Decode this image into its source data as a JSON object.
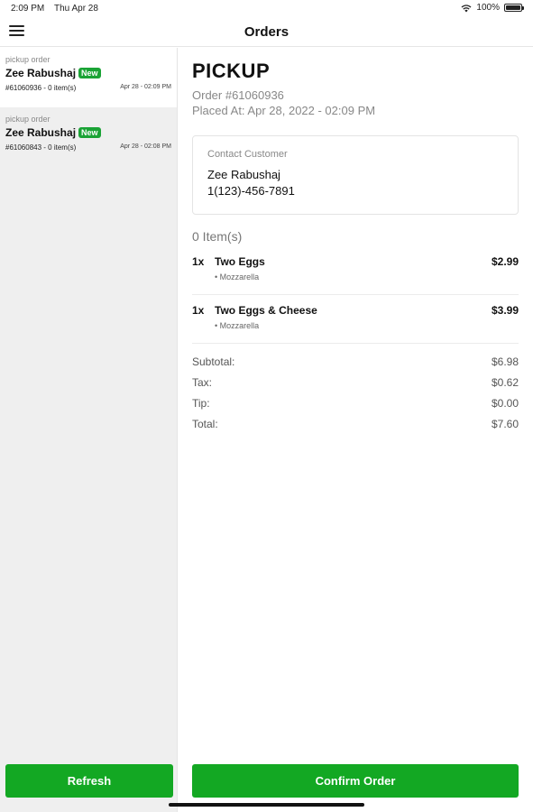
{
  "status_bar": {
    "time": "2:09 PM",
    "date": "Thu Apr 28",
    "battery": "100%",
    "wifi_icon": "wifi-icon",
    "battery_icon": "battery-icon"
  },
  "nav": {
    "title": "Orders",
    "menu_icon": "hamburger-menu-icon"
  },
  "sidebar": {
    "orders": [
      {
        "type": "pickup order",
        "name": "Zee Rabushaj",
        "badge": "New",
        "summary": "#61060936 - 0 item(s)",
        "timestamp": "Apr 28 - 02:09 PM",
        "selected": true
      },
      {
        "type": "pickup order",
        "name": "Zee Rabushaj",
        "badge": "New",
        "summary": "#61060843 - 0 item(s)",
        "timestamp": "Apr 28 - 02:08 PM",
        "selected": false
      }
    ],
    "refresh_label": "Refresh"
  },
  "detail": {
    "title": "PICKUP",
    "order_number": "Order #61060936",
    "placed_at": "Placed At:  Apr 28, 2022 - 02:09 PM",
    "contact": {
      "label": "Contact Customer",
      "name": "Zee Rabushaj",
      "phone": "1(123)-456-7891"
    },
    "items_count": "0 Item(s)",
    "items": [
      {
        "qty": "1x",
        "name": "Two Eggs",
        "price": "$2.99",
        "modifier": "• Mozzarella"
      },
      {
        "qty": "1x",
        "name": "Two Eggs & Cheese",
        "price": "$3.99",
        "modifier": "• Mozzarella"
      }
    ],
    "totals": [
      {
        "label": "Subtotal:",
        "value": "$6.98"
      },
      {
        "label": "Tax:",
        "value": "$0.62"
      },
      {
        "label": "Tip:",
        "value": "$0.00"
      },
      {
        "label": "Total:",
        "value": "$7.60"
      }
    ],
    "confirm_label": "Confirm Order"
  },
  "colors": {
    "accent_green": "#13a823",
    "badge_green": "#1aa335",
    "sidebar_bg": "#efefef"
  }
}
